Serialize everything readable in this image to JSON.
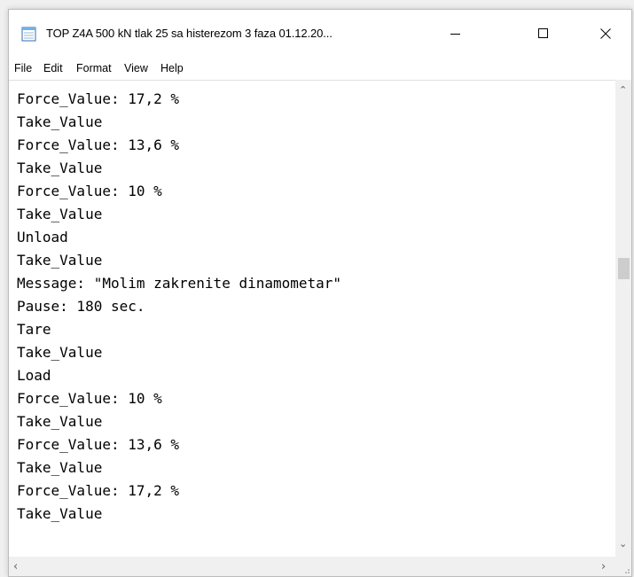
{
  "window": {
    "title": "TOP Z4A 500 kN tlak 25 sa histerezom  3 faza 01.12.20..."
  },
  "controls": {
    "minimize_icon": "minimize-icon",
    "maximize_icon": "maximize-icon",
    "close_icon": "close-icon"
  },
  "menu": {
    "file": "File",
    "edit": "Edit",
    "format": "Format",
    "view": "View",
    "help": "Help"
  },
  "editor": {
    "lines": [
      "Force_Value: 17,2 %",
      "Take_Value",
      "Force_Value: 13,6 %",
      "Take_Value",
      "Force_Value: 10 %",
      "Take_Value",
      "Unload",
      "Take_Value",
      "Message: \"Molim zakrenite dinamometar\"",
      "Pause: 180 sec.",
      "Tare",
      "Take_Value",
      "Load",
      "Force_Value: 10 %",
      "Take_Value",
      "Force_Value: 13,6 %",
      "Take_Value",
      "Force_Value: 17,2 %",
      "Take_Value"
    ]
  }
}
